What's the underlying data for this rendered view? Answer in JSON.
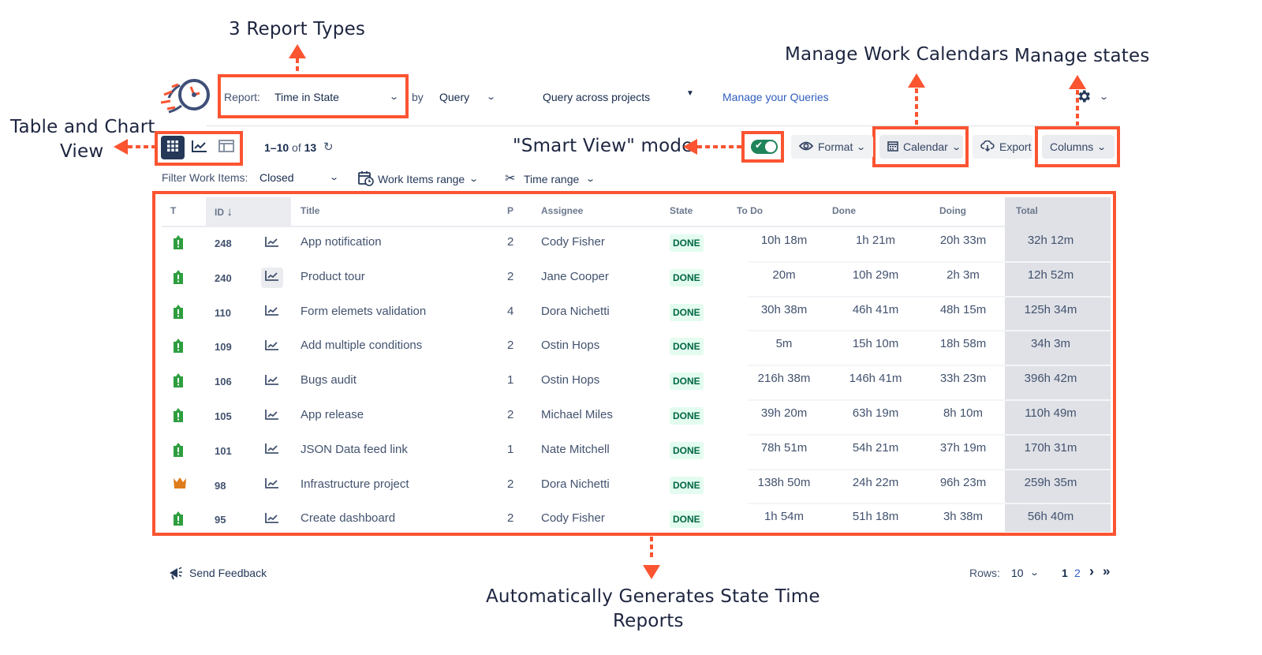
{
  "annotations": {
    "report_types": "3 Report Types",
    "work_calendars": "Manage Work Calendars",
    "manage_states": "Manage  states",
    "table_chart_line1": "Table and Chart",
    "table_chart_line2": "View",
    "smart_view": "\"Smart View\" mode",
    "auto_reports_line1": "Automatically Generates State Time",
    "auto_reports_line2": "Reports"
  },
  "header": {
    "report_label": "Report:",
    "report_value": "Time in State",
    "by_label": "by",
    "by_value": "Query",
    "query_scope": "Query across projects",
    "manage_queries_link": "Manage your Queries"
  },
  "toolbar": {
    "view_modes": [
      {
        "icon": "grid-icon",
        "active": true
      },
      {
        "icon": "chart-icon",
        "active": false
      },
      {
        "icon": "layout-icon",
        "active": false
      }
    ],
    "pagination_range": "1–10",
    "pagination_of": "of",
    "pagination_total": "13",
    "smart_view_enabled": true,
    "format_label": "Format",
    "calendar_label": "Calendar",
    "export_label": "Export",
    "columns_label": "Columns"
  },
  "filters": {
    "label": "Filter Work Items:",
    "status_value": "Closed",
    "work_items_range": "Work Items range",
    "time_range": "Time range"
  },
  "table": {
    "columns": [
      "T",
      "ID",
      "",
      "Title",
      "P",
      "Assignee",
      "State",
      "To Do",
      "Done",
      "Doing",
      "Total"
    ],
    "sort_indicator": "↓",
    "rows": [
      {
        "type": "story",
        "id": "248",
        "title": "App notification",
        "p": "2",
        "assignee": "Cody Fisher",
        "state": "DONE",
        "todo": "10h 18m",
        "done": "1h 21m",
        "doing": "20h 33m",
        "total": "32h 12m"
      },
      {
        "type": "story",
        "id": "240",
        "title": "Product tour",
        "p": "2",
        "assignee": "Jane Cooper",
        "state": "DONE",
        "todo": "20m",
        "done": "10h 29m",
        "doing": "2h 3m",
        "total": "12h 52m"
      },
      {
        "type": "story",
        "id": "110",
        "title": "Form elemets validation",
        "p": "4",
        "assignee": "Dora Nichetti",
        "state": "DONE",
        "todo": "30h 38m",
        "done": "46h 41m",
        "doing": "48h 15m",
        "total": "125h 34m"
      },
      {
        "type": "story",
        "id": "109",
        "title": "Add multiple conditions",
        "p": "2",
        "assignee": "Ostin Hops",
        "state": "DONE",
        "todo": "5m",
        "done": "15h 10m",
        "doing": "18h 58m",
        "total": "34h 3m"
      },
      {
        "type": "story",
        "id": "106",
        "title": "Bugs audit",
        "p": "1",
        "assignee": "Ostin Hops",
        "state": "DONE",
        "todo": "216h 38m",
        "done": "146h 41m",
        "doing": "33h 23m",
        "total": "396h 42m"
      },
      {
        "type": "story",
        "id": "105",
        "title": "App release",
        "p": "2",
        "assignee": "Michael Miles",
        "state": "DONE",
        "todo": "39h 20m",
        "done": "63h 19m",
        "doing": "8h 10m",
        "total": "110h 49m"
      },
      {
        "type": "story",
        "id": "101",
        "title": "JSON Data feed link",
        "p": "1",
        "assignee": "Nate Mitchell",
        "state": "DONE",
        "todo": "78h 51m",
        "done": "54h 21m",
        "doing": "37h 19m",
        "total": "170h 31m"
      },
      {
        "type": "epic",
        "id": "98",
        "title": "Infrastructure project",
        "p": "2",
        "assignee": "Dora Nichetti",
        "state": "DONE",
        "todo": "138h 50m",
        "done": "24h 22m",
        "doing": "96h 23m",
        "total": "259h 35m"
      },
      {
        "type": "story",
        "id": "95",
        "title": "Create dashboard",
        "p": "2",
        "assignee": "Cody Fisher",
        "state": "DONE",
        "todo": "1h 54m",
        "done": "51h 18m",
        "doing": "3h 38m",
        "total": "56h 40m"
      }
    ]
  },
  "footer": {
    "feedback_label": "Send Feedback",
    "rows_label": "Rows:",
    "rows_value": "10",
    "pages": [
      "1",
      "2"
    ],
    "current_page": "1",
    "next": "›",
    "last": "»"
  },
  "colors": {
    "annotation_accent": "#fb5431",
    "active_view": "#253858",
    "link": "#2f5dbf",
    "done_badge_bg": "#e3fcef",
    "done_badge_text": "#006644",
    "toggle_on": "#1f845a",
    "story_icon": "#2e9e3f",
    "epic_icon": "#e07b1a"
  }
}
